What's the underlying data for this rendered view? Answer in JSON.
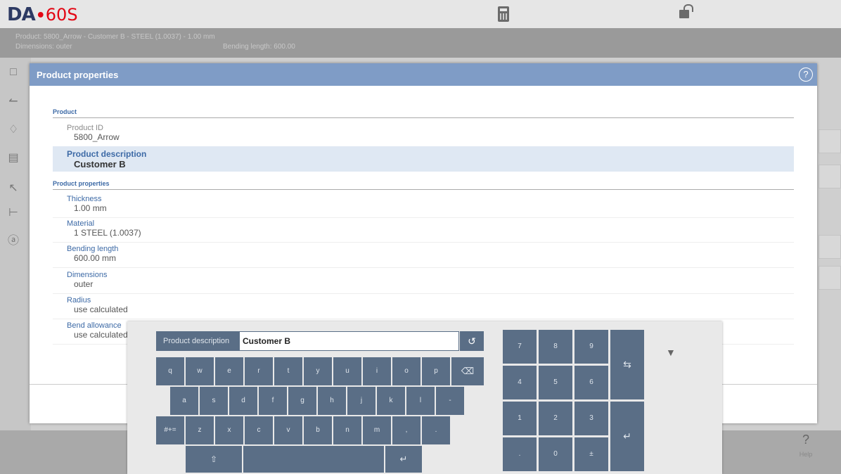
{
  "app": {
    "logo_main": "DA",
    "logo_dot": "•",
    "logo_model": "60S"
  },
  "infobar": {
    "product_line": "Product: 5800_Arrow - Customer B - STEEL (1.0037) - 1.00 mm",
    "dimensions_line": "Dimensions: outer",
    "bending_line": "Bending length: 600.00"
  },
  "dialog": {
    "title": "Product properties",
    "help_glyph": "?",
    "section_product": "Product",
    "section_properties": "Product properties",
    "product_id": {
      "label": "Product ID",
      "value": "5800_Arrow"
    },
    "product_description": {
      "label": "Product description",
      "value": "Customer B"
    },
    "thickness": {
      "label": "Thickness",
      "value": "1.00 mm"
    },
    "material": {
      "label": "Material",
      "value": "1 STEEL (1.0037)"
    },
    "bending_length": {
      "label": "Bending length",
      "value": "600.00 mm"
    },
    "dimensions": {
      "label": "Dimensions",
      "value": "outer"
    },
    "radius": {
      "label": "Radius",
      "value": "use calculated"
    },
    "bend_allowance": {
      "label": "Bend allowance",
      "value": "use calculated"
    }
  },
  "keyboard": {
    "field_label": "Product description",
    "field_value": "Customer B",
    "undo_glyph": "↺",
    "collapse_glyph": "▼",
    "row1": [
      "q",
      "w",
      "e",
      "r",
      "t",
      "y",
      "u",
      "i",
      "o",
      "p"
    ],
    "backspace": "⌫",
    "row2": [
      "a",
      "s",
      "d",
      "f",
      "g",
      "h",
      "j",
      "k",
      "l",
      "-"
    ],
    "symbols": "#+=",
    "row3": [
      "z",
      "x",
      "c",
      "v",
      "b",
      "n",
      "m",
      ",",
      "."
    ],
    "shift": "⇧",
    "enter": "↵",
    "numpad": [
      "7",
      "8",
      "9",
      "4",
      "5",
      "6",
      "1",
      "2",
      "3",
      ".",
      "0",
      "±"
    ],
    "tab_glyph": "⇆"
  },
  "help": {
    "glyph": "?",
    "label": "Help"
  }
}
